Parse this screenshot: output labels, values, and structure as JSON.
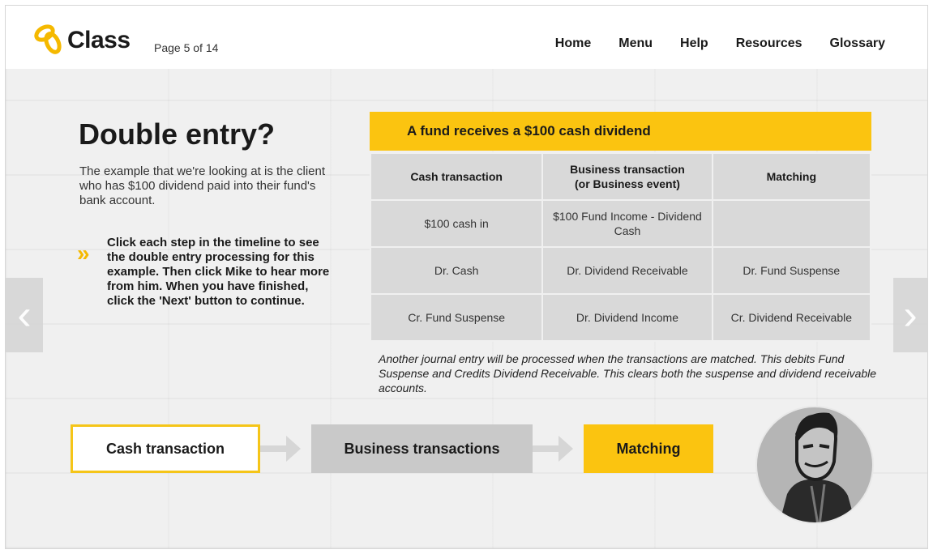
{
  "header": {
    "logo_text": "Class",
    "page_indicator": "Page 5 of 14",
    "nav": [
      "Home",
      "Menu",
      "Help",
      "Resources",
      "Glossary"
    ]
  },
  "left": {
    "title": "Double entry?",
    "intro": "The example that we're looking at is the client who has $100 dividend paid into their fund's bank account.",
    "instruction": "Click each step in the timeline to see the double entry processing for this example. Then click Mike to hear more from him. When you have finished, click the 'Next' button to continue."
  },
  "table": {
    "caption": "A fund receives a $100 cash dividend",
    "headers": [
      "Cash transaction",
      "Business transaction\n(or Business event)",
      "Matching"
    ],
    "rows": [
      [
        "$100 cash in",
        "$100 Fund Income - Dividend Cash",
        ""
      ],
      [
        "Dr. Cash",
        "Dr. Dividend Receivable",
        "Dr. Fund Suspense"
      ],
      [
        "Cr. Fund Suspense",
        "Dr. Dividend Income",
        "Cr. Dividend Receivable"
      ]
    ]
  },
  "note": "Another journal entry will be processed when the transactions are matched. This debits Fund Suspense and Credits Dividend Receivable. This clears both the suspense and dividend receivable accounts.",
  "timeline": {
    "steps": [
      "Cash transaction",
      "Business transactions",
      "Matching"
    ]
  },
  "side_nav": {
    "prev": "‹",
    "next": "›"
  },
  "colors": {
    "accent": "#fbc410",
    "cell": "#d9d9d9",
    "step_gray": "#c9c9c9"
  },
  "icons": {
    "logo": "logo-loop-icon",
    "chevron": "double-chevron-icon",
    "mike": "mike-avatar-icon"
  }
}
